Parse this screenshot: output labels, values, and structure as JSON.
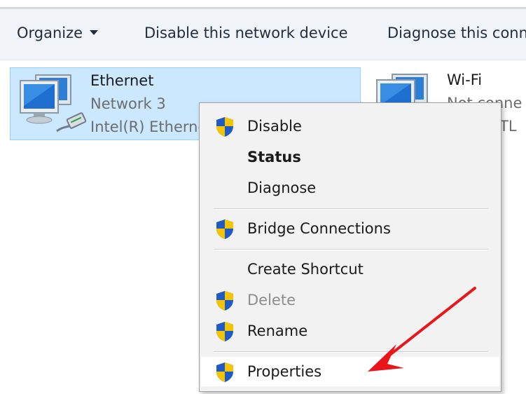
{
  "toolbar": {
    "organize_label": "Organize",
    "disable_label": "Disable this network device",
    "diagnose_label": "Diagnose this conn"
  },
  "adapters": [
    {
      "name": "Ethernet",
      "network": "Network 3",
      "device": "Intel(R) Etherne",
      "selected": true
    },
    {
      "name": "Wi-Fi",
      "network": "Not conne",
      "device": "RTL",
      "selected": false
    }
  ],
  "context_menu": {
    "items": [
      {
        "label": "Disable",
        "shield": true,
        "bold": false,
        "disabled": false
      },
      {
        "label": "Status",
        "shield": false,
        "bold": true,
        "disabled": false
      },
      {
        "label": "Diagnose",
        "shield": false,
        "bold": false,
        "disabled": false
      },
      {
        "label": "Bridge Connections",
        "shield": true,
        "bold": false,
        "disabled": false
      },
      {
        "label": "Create Shortcut",
        "shield": false,
        "bold": false,
        "disabled": false
      },
      {
        "label": "Delete",
        "shield": true,
        "bold": false,
        "disabled": true
      },
      {
        "label": "Rename",
        "shield": true,
        "bold": false,
        "disabled": false
      },
      {
        "label": "Properties",
        "shield": true,
        "bold": false,
        "disabled": false,
        "highlighted": true
      }
    ]
  },
  "icons": {
    "uac_shield": "uac-shield-icon",
    "ethernet": "ethernet-adapter-icon",
    "wifi": "wifi-adapter-icon",
    "annotation": "red-arrow-icon"
  },
  "colors": {
    "selection_bg": "#cce8ff",
    "selection_border": "#99d1ff",
    "menu_bg": "#f2f2f2",
    "arrow": "#e8161b",
    "shield_blue": "#1e5bc6",
    "shield_yellow": "#f5c400"
  }
}
